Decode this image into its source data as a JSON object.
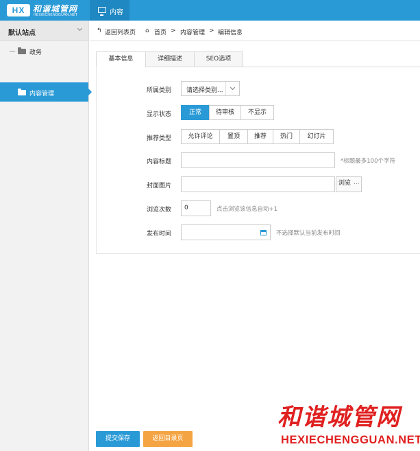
{
  "app": {
    "logo_badge": "HX",
    "logo_cn": "和谐城管网",
    "logo_en": "HEXIECHENGGUAN.NET",
    "top_tab": "内容",
    "accent_color": "#2a9ad7",
    "warning_color": "#f5a443"
  },
  "sidebar": {
    "site_label": "默认站点",
    "items": [
      {
        "label": "政务",
        "icon": "folder-icon",
        "active": false
      },
      {
        "label": "内容管理",
        "icon": "folder-open-icon",
        "active": true
      }
    ]
  },
  "breadcrumb": {
    "back": "返回列表页",
    "home": "首页",
    "sep": ">",
    "level2": "内容管理",
    "level3": "编辑信息"
  },
  "tabs": [
    {
      "label": "基本信息",
      "active": true
    },
    {
      "label": "详细描述",
      "active": false
    },
    {
      "label": "SEO选项",
      "active": false
    }
  ],
  "form": {
    "category": {
      "label": "所属类别",
      "value": "请选择类别..."
    },
    "status": {
      "label": "显示状态",
      "options": [
        "正常",
        "待审核",
        "不显示"
      ],
      "selected": "正常"
    },
    "recommend": {
      "label": "推荐类型",
      "options": [
        "允许评论",
        "置顶",
        "推荐",
        "热门",
        "幻灯片"
      ]
    },
    "title": {
      "label": "内容标题",
      "value": "",
      "hint": "*标题最多100个字符"
    },
    "cover": {
      "label": "封面图片",
      "value": "",
      "browse": "浏览",
      "browse_dots": "..."
    },
    "views": {
      "label": "浏览次数",
      "value": "0",
      "hint": "点击浏览该信息自动+1"
    },
    "publish": {
      "label": "发布时间",
      "value": "",
      "hint": "不选择默认当前发布时间"
    }
  },
  "footer": {
    "save": "提交保存",
    "back": "返回目录页"
  },
  "watermark": {
    "cn": "和谐城管网",
    "en": "HEXIECHENGGUAN.NET"
  }
}
